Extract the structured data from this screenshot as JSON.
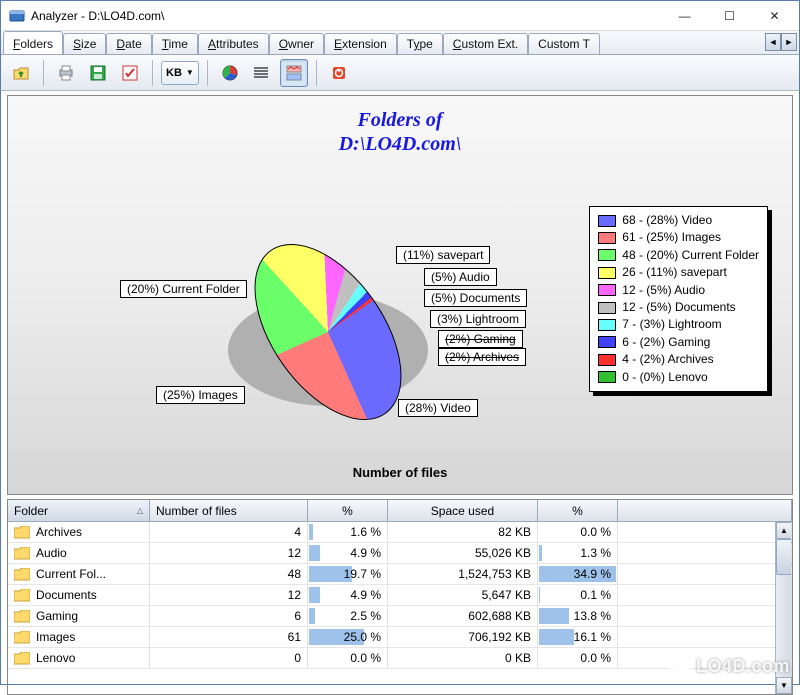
{
  "window": {
    "title": "Analyzer - D:\\LO4D.com\\",
    "min": "—",
    "max": "☐",
    "close": "✕"
  },
  "tabs": {
    "items": [
      {
        "label_pre": "",
        "ul": "F",
        "label_post": "olders",
        "active": true
      },
      {
        "label_pre": "",
        "ul": "S",
        "label_post": "ize"
      },
      {
        "label_pre": "",
        "ul": "D",
        "label_post": "ate"
      },
      {
        "label_pre": "",
        "ul": "T",
        "label_post": "ime"
      },
      {
        "label_pre": "",
        "ul": "A",
        "label_post": "ttributes"
      },
      {
        "label_pre": "",
        "ul": "O",
        "label_post": "wner"
      },
      {
        "label_pre": "",
        "ul": "E",
        "label_post": "xtension"
      },
      {
        "label_pre": "T",
        "ul": "y",
        "label_post": "pe"
      },
      {
        "label_pre": "",
        "ul": "C",
        "label_post": "ustom Ext."
      },
      {
        "label_pre": "Custom T",
        "ul": "",
        "label_post": ""
      }
    ],
    "scroll_left": "◄",
    "scroll_right": "►"
  },
  "toolbar": {
    "kb_label": "KB",
    "kb_caret": "▼"
  },
  "chart": {
    "title_line1": "Folders of",
    "title_line2": "D:\\LO4D.com\\",
    "subtitle": "Number of files",
    "callouts": {
      "video": "(28%) Video",
      "images": "(25%) Images",
      "current": "(20%) Current Folder",
      "savepart": "(11%) savepart",
      "audio": "(5%) Audio",
      "documents": "(5%) Documents",
      "lightroom": "(3%) Lightroom",
      "gaming": "(2%) Gaming",
      "archives": "(2%) Archives"
    },
    "legend": [
      {
        "color": "#6a6aff",
        "text": "68 - (28%) Video"
      },
      {
        "color": "#ff7a7a",
        "text": "61 - (25%) Images"
      },
      {
        "color": "#6aff6a",
        "text": "48 - (20%) Current Folder"
      },
      {
        "color": "#ffff66",
        "text": "26 - (11%) savepart"
      },
      {
        "color": "#ff66ff",
        "text": "12 - (5%) Audio"
      },
      {
        "color": "#c0c0c0",
        "text": "12 - (5%) Documents"
      },
      {
        "color": "#66ffff",
        "text": "7 - (3%) Lightroom"
      },
      {
        "color": "#4040ff",
        "text": "6 - (2%) Gaming"
      },
      {
        "color": "#ff3030",
        "text": "4 - (2%) Archives"
      },
      {
        "color": "#30c030",
        "text": "0 - (0%) Lenovo"
      }
    ]
  },
  "chart_data": {
    "type": "pie",
    "title": "Folders of D:\\LO4D.com\\",
    "subtitle": "Number of files",
    "series": [
      {
        "name": "Number of files",
        "values": [
          68,
          61,
          48,
          26,
          12,
          12,
          7,
          6,
          4,
          0
        ]
      }
    ],
    "categories": [
      "Video",
      "Images",
      "Current Folder",
      "savepart",
      "Audio",
      "Documents",
      "Lightroom",
      "Gaming",
      "Archives",
      "Lenovo"
    ],
    "percentages": [
      28,
      25,
      20,
      11,
      5,
      5,
      3,
      2,
      2,
      0
    ],
    "colors": [
      "#6a6aff",
      "#ff7a7a",
      "#6aff6a",
      "#ffff66",
      "#ff66ff",
      "#c0c0c0",
      "#66ffff",
      "#4040ff",
      "#ff3030",
      "#30c030"
    ]
  },
  "grid": {
    "headers": {
      "folder": "Folder",
      "nfiles": "Number of files",
      "pct1": "%",
      "space": "Space used",
      "pct2": "%"
    },
    "rows": [
      {
        "folder": "Archives",
        "nfiles": "4",
        "pct1": "1.6 %",
        "pct1v": 1.6,
        "space": "82 KB",
        "pct2": "0.0 %",
        "pct2v": 0.0
      },
      {
        "folder": "Audio",
        "nfiles": "12",
        "pct1": "4.9 %",
        "pct1v": 4.9,
        "space": "55,026 KB",
        "pct2": "1.3 %",
        "pct2v": 1.3
      },
      {
        "folder": "Current Fol...",
        "nfiles": "48",
        "pct1": "19.7 %",
        "pct1v": 19.7,
        "space": "1,524,753 KB",
        "pct2": "34.9 %",
        "pct2v": 34.9
      },
      {
        "folder": "Documents",
        "nfiles": "12",
        "pct1": "4.9 %",
        "pct1v": 4.9,
        "space": "5,647 KB",
        "pct2": "0.1 %",
        "pct2v": 0.1
      },
      {
        "folder": "Gaming",
        "nfiles": "6",
        "pct1": "2.5 %",
        "pct1v": 2.5,
        "space": "602,688 KB",
        "pct2": "13.8 %",
        "pct2v": 13.8
      },
      {
        "folder": "Images",
        "nfiles": "61",
        "pct1": "25.0 %",
        "pct1v": 25.0,
        "space": "706,192 KB",
        "pct2": "16.1 %",
        "pct2v": 16.1
      },
      {
        "folder": "Lenovo",
        "nfiles": "0",
        "pct1": "0.0 %",
        "pct1v": 0.0,
        "space": "0 KB",
        "pct2": "0.0 %",
        "pct2v": 0.0
      }
    ]
  },
  "watermark": "LO4D.com"
}
